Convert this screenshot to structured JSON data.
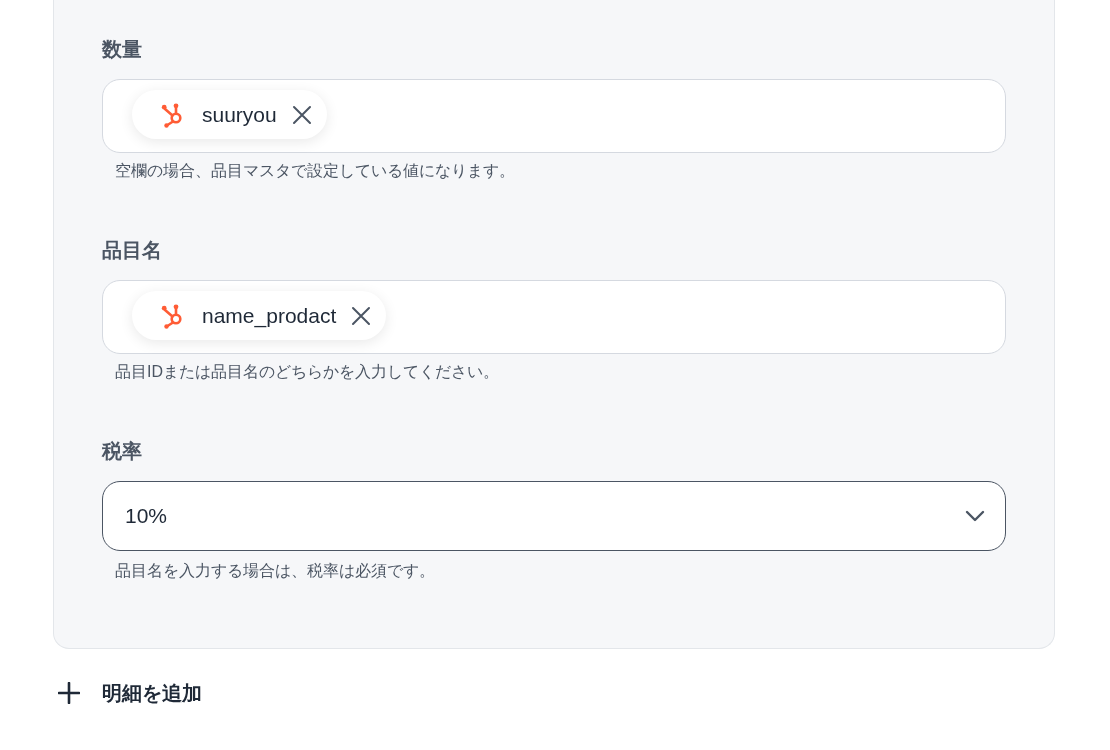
{
  "fields": [
    {
      "label": "数量",
      "kind": "token",
      "tokens": [
        {
          "text": "suuryou"
        }
      ],
      "hint": "空欄の場合、品目マスタで設定している値になります。"
    },
    {
      "label": "品目名",
      "kind": "token",
      "tokens": [
        {
          "text": "name_prodact"
        }
      ],
      "hint": "品目IDまたは品目名のどちらかを入力してください。"
    },
    {
      "label": "税率",
      "kind": "select",
      "value": "10%",
      "hint": "品目名を入力する場合は、税率は必須です。"
    }
  ],
  "add_button": {
    "label": "明細を追加"
  }
}
